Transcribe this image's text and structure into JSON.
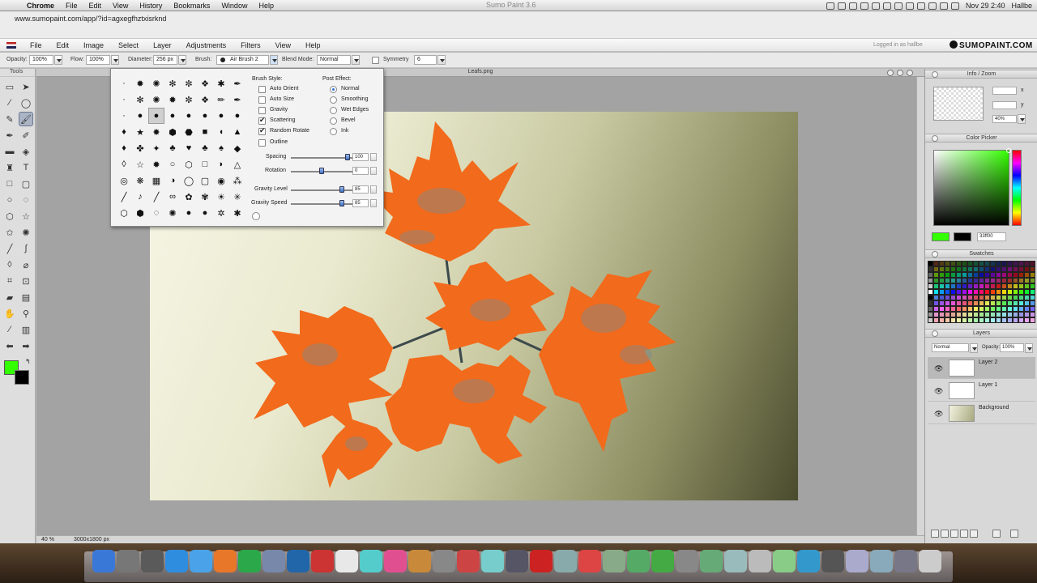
{
  "os": {
    "menu": [
      "Chrome",
      "File",
      "Edit",
      "View",
      "History",
      "Bookmarks",
      "Window",
      "Help"
    ],
    "window_title": "Sumo Paint 3.6",
    "clock": "Nov 29  2:40",
    "user": "Hallbe"
  },
  "browser": {
    "url": "www.sumopaint.com/app/?id=agxegfhztxisrknd"
  },
  "app": {
    "menu": [
      "File",
      "Edit",
      "Image",
      "Select",
      "Layer",
      "Adjustments",
      "Filters",
      "View",
      "Help"
    ],
    "login": "Logged in as hallbe",
    "logo": "SUMOPAINT.COM"
  },
  "options": {
    "opacity_label": "Opacity:",
    "opacity": "100%",
    "flow_label": "Flow:",
    "flow": "100%",
    "diameter_label": "Diameter:",
    "diameter": "256 px",
    "brush_label": "Brush:",
    "brush": "Air Brush 2",
    "blend_label": "Blend Mode:",
    "blend": "Normal",
    "symmetry_label": "Symmetry",
    "symmetry": "6"
  },
  "tools": {
    "title": "Tools"
  },
  "document": {
    "title": "Leafs.png",
    "zoom": "40 %",
    "size": "3000x1800 px"
  },
  "brush_popup": {
    "style_title": "Brush Style:",
    "post_title": "Post Effect:",
    "styles": [
      {
        "label": "Auto Orient",
        "checked": false
      },
      {
        "label": "Auto Size",
        "checked": false
      },
      {
        "label": "Gravity",
        "checked": false
      },
      {
        "label": "Scattering",
        "checked": true
      },
      {
        "label": "Random Rotate",
        "checked": true
      },
      {
        "label": "Outline",
        "checked": false
      }
    ],
    "effects": [
      {
        "label": "Normal",
        "selected": true
      },
      {
        "label": "Smoothing",
        "selected": false
      },
      {
        "label": "Wet Edges",
        "selected": false
      },
      {
        "label": "Bevel",
        "selected": false
      },
      {
        "label": "Ink",
        "selected": false
      }
    ],
    "sliders": [
      {
        "label": "Spacing",
        "value": "100",
        "level": 0.95
      },
      {
        "label": "Rotation",
        "value": "0",
        "level": 0.5
      },
      {
        "label": "Gravity Level",
        "value": "85",
        "level": 0.85
      },
      {
        "label": "Gravity Speed",
        "value": "85",
        "level": 0.85
      }
    ]
  },
  "panels": {
    "info_title": "Info / Zoom",
    "info_x_label": "x",
    "info_y_label": "y",
    "zoom": "40%",
    "color_title": "Color Picker",
    "color_hex": "33ff00",
    "swatches_title": "Swatches",
    "layers_title": "Layers",
    "layer_mode": "Normal",
    "layer_opacity_label": "Opacity:",
    "layer_opacity": "100%",
    "layers": [
      "Layer 2",
      "Layer 1",
      "Background"
    ]
  },
  "colors": {
    "foreground": "#33ff00",
    "background": "#000000",
    "leaf": "#f26a1b"
  }
}
